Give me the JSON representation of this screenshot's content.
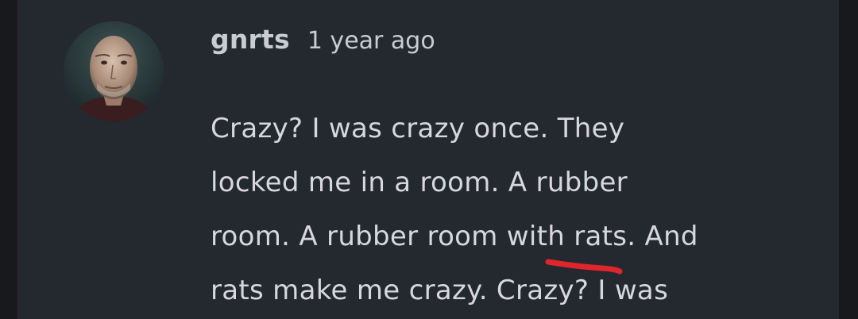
{
  "comment": {
    "username": "gnrts",
    "timestamp": "1 year ago",
    "lines": [
      "Crazy? I was crazy once. They",
      "locked me in a room. A rubber",
      "room. A rubber room with rats. And",
      "rats make me crazy. Crazy? I was"
    ]
  },
  "colors": {
    "background": "#24282f",
    "text": "#d6d8dc",
    "annotation": "#e0252b"
  },
  "icons": {
    "avatar": "user-avatar-photo"
  }
}
